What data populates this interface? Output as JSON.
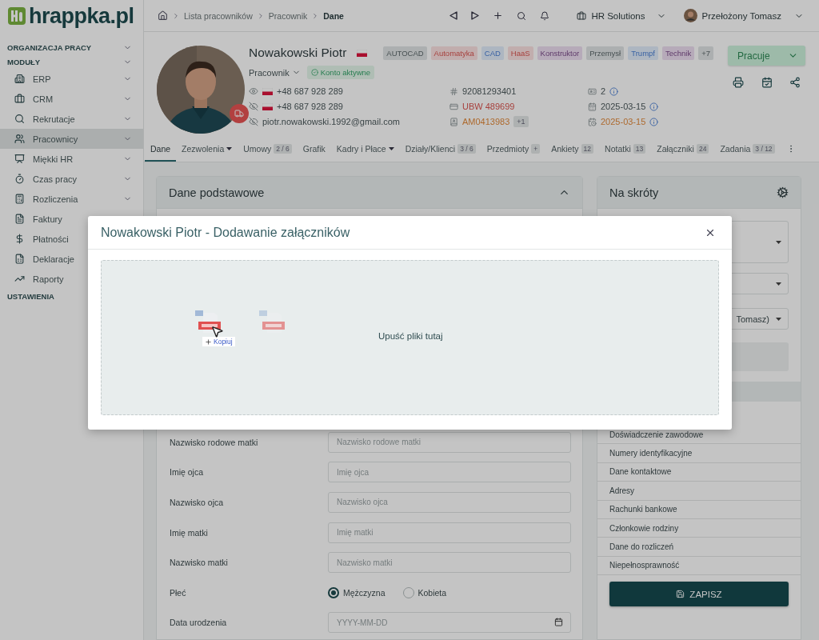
{
  "logo": {
    "text": "hrappka.pl"
  },
  "sidebar": {
    "sections": [
      {
        "label": "ORGANIZACJA PRACY",
        "kind": "collapsible"
      },
      {
        "label": "MODUŁY",
        "kind": "collapsible",
        "items": [
          {
            "label": "ERP",
            "selected": false
          },
          {
            "label": "CRM",
            "selected": false
          },
          {
            "label": "Rekrutacje",
            "selected": false
          },
          {
            "label": "Pracownicy",
            "selected": true
          },
          {
            "label": "Miękki HR",
            "selected": false
          },
          {
            "label": "Czas pracy",
            "selected": false
          },
          {
            "label": "Rozliczenia",
            "selected": false
          },
          {
            "label": "Faktury",
            "selected": false
          },
          {
            "label": "Płatności",
            "selected": false
          },
          {
            "label": "Deklaracje",
            "selected": false
          },
          {
            "label": "Raporty",
            "selected": false
          }
        ]
      },
      {
        "label": "USTAWIENIA",
        "kind": "plain"
      }
    ]
  },
  "breadcrumb": [
    "Lista pracowników",
    "Pracownik",
    "Dane"
  ],
  "topbar": {
    "company": "HR Solutions",
    "user": "Przełożony Tomasz"
  },
  "profile": {
    "name": "Nowakowski Piotr",
    "role": "Pracownik",
    "status": "Konto aktywne",
    "tags": [
      {
        "label": "AUTOCAD",
        "color": "#acafb0"
      },
      {
        "label": "Automatyka",
        "color": "#c1adad"
      },
      {
        "label": "CAD",
        "color": "#adb6c1"
      },
      {
        "label": "HaaS",
        "color": "#c1adad"
      },
      {
        "label": "Konstruktor",
        "color": "#b6aab9"
      },
      {
        "label": "Przemysł",
        "color": "#acafb0"
      },
      {
        "label": "Trumpf",
        "color": "#adb6c1"
      },
      {
        "label": "Technik",
        "color": "#b6aab9"
      },
      {
        "label": "+7",
        "color": "#acafb0"
      }
    ],
    "contacts": [
      {
        "kind": "phone",
        "visible": true,
        "value": "+48 687 928 289"
      },
      {
        "kind": "phone",
        "visible": false,
        "value": "+48 687 928 289"
      },
      {
        "kind": "email",
        "visible": false,
        "value": "piotr.nowakowski.1992@gmail.com"
      }
    ],
    "documents": [
      {
        "value": "92081293401",
        "color": "#3a4446"
      },
      {
        "value": "UBW 489699",
        "color": "#a7403d"
      },
      {
        "value": "AM0413983",
        "color": "#ad692d",
        "extra": "+1"
      }
    ],
    "details": [
      {
        "value": "2"
      },
      {
        "value": "2025-03-15",
        "color": "#3a4446"
      },
      {
        "value": "2025-03-15",
        "color": "#ad692d"
      }
    ],
    "work_status": "Pracuje"
  },
  "tabs": [
    {
      "label": "Dane",
      "selected": true
    },
    {
      "label": "Zezwolenia",
      "selected": false,
      "dropdown": true
    },
    {
      "label": "Umowy",
      "selected": false,
      "badge": "2 / 6"
    },
    {
      "label": "Grafik",
      "selected": false
    },
    {
      "label": "Kadry i Płace",
      "selected": false,
      "dropdown": true
    },
    {
      "label": "Działy/Klienci",
      "selected": false,
      "badge": "3 / 6"
    },
    {
      "label": "Przedmioty",
      "selected": false,
      "badge": "+"
    },
    {
      "label": "Ankiety",
      "selected": false,
      "badge": "12"
    },
    {
      "label": "Notatki",
      "selected": false,
      "badge": "13"
    },
    {
      "label": "Załączniki",
      "selected": false,
      "badge": "24"
    },
    {
      "label": "Zadania",
      "selected": false,
      "badge": "3 / 12"
    }
  ],
  "basic_card": {
    "title": "Dane podstawowe",
    "expanded": true,
    "fields": [
      {
        "kind": "text",
        "label": "Nazwisko rodowe matki",
        "placeholder": "Nazwisko rodowe matki"
      },
      {
        "kind": "text",
        "label": "Imię ojca",
        "placeholder": "Imię ojca"
      },
      {
        "kind": "text",
        "label": "Nazwisko ojca",
        "placeholder": "Nazwisko ojca"
      },
      {
        "kind": "text",
        "label": "Imię matki",
        "placeholder": "Imię matki"
      },
      {
        "kind": "text",
        "label": "Nazwisko matki",
        "placeholder": "Nazwisko matki"
      },
      {
        "kind": "radio",
        "label": "Płeć",
        "options": [
          {
            "label": "Mężczyzna",
            "selected": true
          },
          {
            "label": "Kobieta",
            "selected": false
          }
        ]
      },
      {
        "kind": "date",
        "label": "Data urodzenia",
        "placeholder": "YYYY-MM-DD"
      }
    ]
  },
  "shortcuts_card": {
    "title": "Na skróty",
    "filter_value": "Tomasz)",
    "links": [
      "Doświadczenie zawodowe",
      "Numery identyfikacyjne",
      "Dane kontaktowe",
      "Adresy",
      "Rachunki bankowe",
      "Członkowie rodziny",
      "Dane do rozliczeń",
      "Niepełnosprawność"
    ],
    "save": "ZAPISZ"
  },
  "modal": {
    "title": "Nowakowski Piotr - Dodawanie załączników",
    "drop_text": "Upuść pliki tutaj",
    "drag_label": "Kopiuj"
  }
}
